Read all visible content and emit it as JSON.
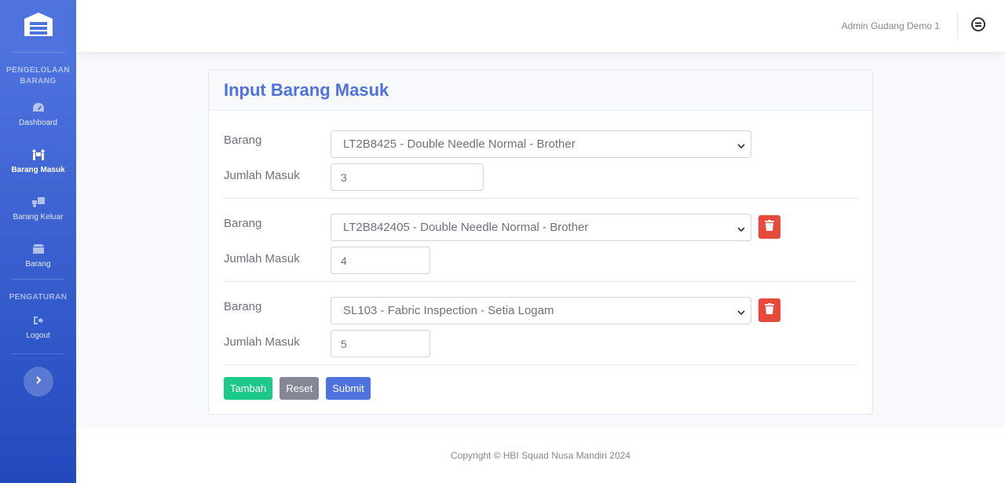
{
  "sidebar": {
    "brand_icon": "warehouse-icon",
    "section1_heading": "PENGELOLAAN BARANG",
    "items": [
      {
        "label": "Dashboard",
        "icon": "tachometer-icon",
        "active": false
      },
      {
        "label": "Barang Masuk",
        "icon": "people-carry-icon",
        "active": true
      },
      {
        "label": "Barang Keluar",
        "icon": "truck-loading-icon",
        "active": false
      },
      {
        "label": "Barang",
        "icon": "box-icon",
        "active": false
      }
    ],
    "section2_heading": "PENGATURAN",
    "logout_label": "Logout",
    "toggle_icon": "chevron-right-icon"
  },
  "topbar": {
    "user_name": "Admin Gudang Demo 1",
    "user_icon": "user-circle-icon"
  },
  "form": {
    "title": "Input Barang Masuk",
    "barang_label": "Barang",
    "jumlah_label": "Jumlah Masuk",
    "rows": [
      {
        "barang": "LT2B8425 - Double Needle Normal - Brother",
        "jumlah": "3",
        "deletable": false
      },
      {
        "barang": "LT2B842405 - Double Needle Normal - Brother",
        "jumlah": "4",
        "deletable": true
      },
      {
        "barang": "SL103 - Fabric Inspection - Setia Logam",
        "jumlah": "5",
        "deletable": true
      }
    ],
    "buttons": {
      "tambah": "Tambah",
      "reset": "Reset",
      "submit": "Submit"
    }
  },
  "footer": {
    "copyright": "Copyright © HBI Squad Nusa Mandiri 2024"
  },
  "colors": {
    "primary": "#4e73df",
    "success": "#1cc88a",
    "secondary": "#858796",
    "danger": "#e74a3b"
  }
}
